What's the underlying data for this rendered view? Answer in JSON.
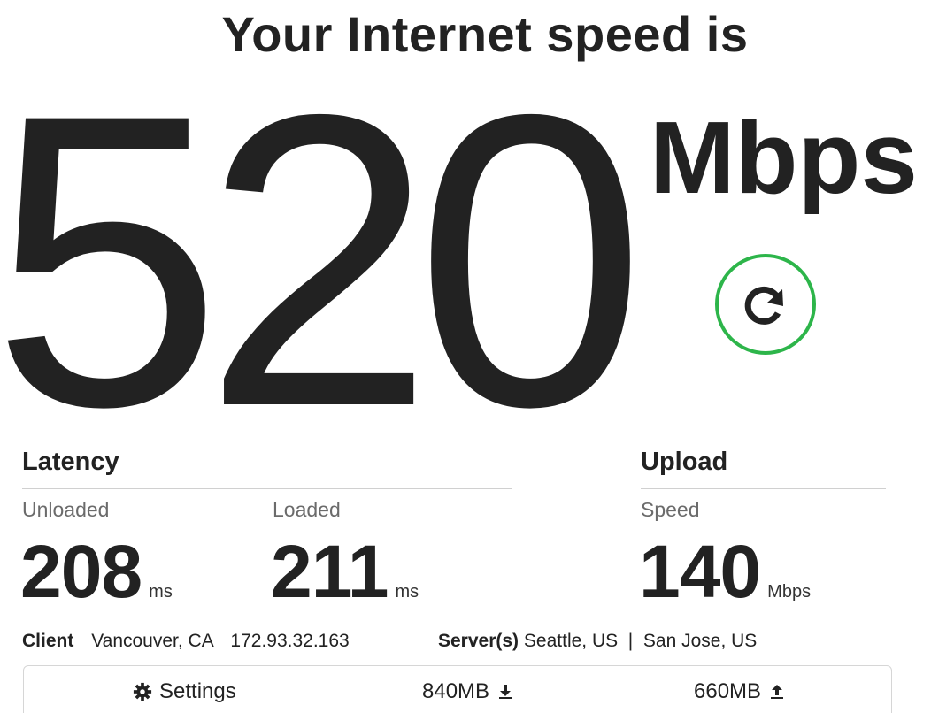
{
  "header": {
    "title": "Your Internet speed is"
  },
  "speed": {
    "value": "520",
    "units": "Mbps"
  },
  "refresh": {
    "icon": "refresh-icon",
    "accent_color": "#2db54a"
  },
  "latency": {
    "title": "Latency",
    "unloaded_label": "Unloaded",
    "unloaded_value": "208",
    "unloaded_unit": "ms",
    "loaded_label": "Loaded",
    "loaded_value": "211",
    "loaded_unit": "ms"
  },
  "upload": {
    "title": "Upload",
    "speed_label": "Speed",
    "speed_value": "140",
    "speed_unit": "Mbps"
  },
  "client": {
    "label": "Client",
    "location": "Vancouver, CA",
    "ip": "172.93.32.163"
  },
  "servers": {
    "label": "Server(s)",
    "list": "Seattle, US  |  San Jose, US"
  },
  "footer": {
    "settings_label": "Settings",
    "download_data": "840MB",
    "upload_data": "660MB",
    "settings_icon": "gear-icon",
    "download_icon": "download-icon",
    "upload_icon": "upload-icon"
  }
}
